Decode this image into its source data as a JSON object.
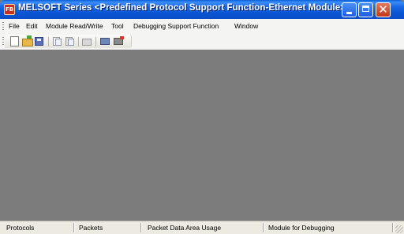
{
  "window": {
    "title": "MELSOFT Series <Predefined Protocol Support Function-Ethernet Module>",
    "app_icon_text": "FB",
    "controls": {
      "minimize": "minimize-icon",
      "maximize": "maximize-icon",
      "close": "close-icon",
      "close_glyph": "✕"
    }
  },
  "menu": {
    "items": [
      {
        "label": "File"
      },
      {
        "label": "Edit"
      },
      {
        "label": "Module Read/Write"
      },
      {
        "label": "Tool"
      },
      {
        "label": "Debugging Support Function"
      },
      {
        "label": "Window"
      }
    ]
  },
  "toolbar": {
    "buttons": [
      {
        "icon": "new-file-icon"
      },
      {
        "icon": "open-folder-icon"
      },
      {
        "icon": "save-icon"
      },
      {
        "icon": "copy-icon"
      },
      {
        "icon": "paste-icon"
      },
      {
        "icon": "print-icon"
      },
      {
        "icon": "read-module-icon"
      },
      {
        "icon": "write-module-icon"
      }
    ]
  },
  "statusbar": {
    "panes": [
      {
        "label": "Protocols"
      },
      {
        "label": "Packets"
      },
      {
        "label": "Packet Data Area Usage"
      },
      {
        "label": "Module for Debugging"
      }
    ]
  },
  "colors": {
    "titlebar": "#0a55d2",
    "client_area": "#7c7c7c",
    "menu_background": "#f4f4f2",
    "statusbar_background": "#eceae1"
  }
}
